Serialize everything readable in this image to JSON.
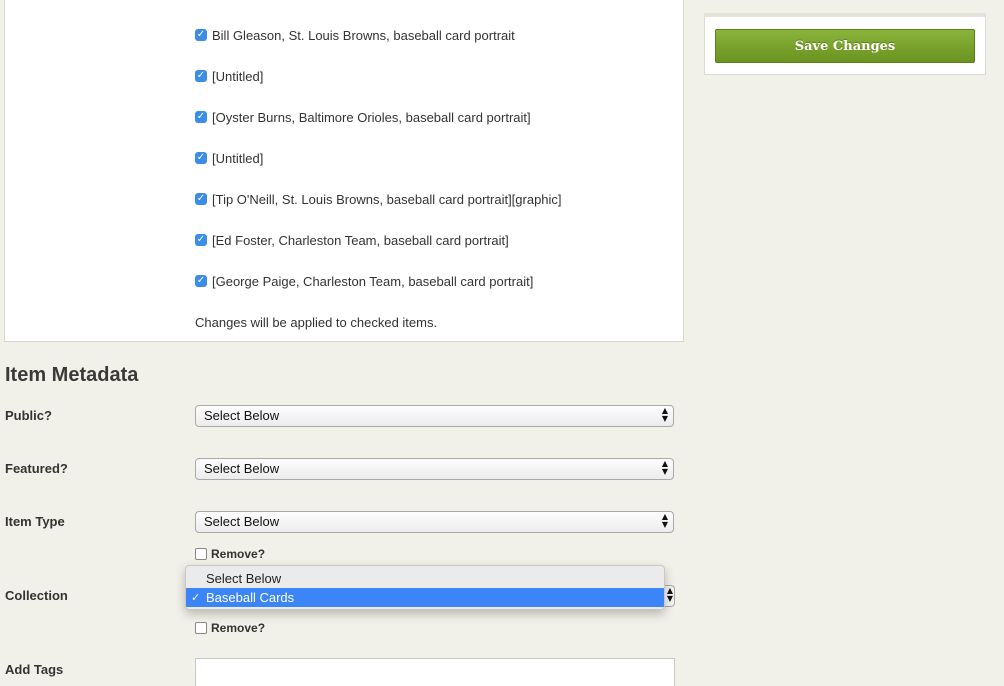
{
  "selected_items": [
    "Bill Gleason, St. Louis Browns, baseball card portrait",
    "[Untitled]",
    "[Oyster Burns, Baltimore Orioles, baseball card portrait]",
    "[Untitled]",
    "[Tip O'Neill, St. Louis Browns, baseball card portrait][graphic]",
    "[Ed Foster, Charleston Team, baseball card portrait]",
    "[George Paige, Charleston Team, baseball card portrait]"
  ],
  "note": "Changes will be applied to checked items.",
  "save_button": "Save Changes",
  "metadata": {
    "title": "Item Metadata",
    "public_label": "Public?",
    "public_value": "Select Below",
    "featured_label": "Featured?",
    "featured_value": "Select Below",
    "item_type_label": "Item Type",
    "item_type_value": "Select Below",
    "item_type_remove": "Remove?",
    "collection_label": "Collection",
    "collection_options": [
      "Select Below",
      "Baseball Cards"
    ],
    "collection_selected": "Baseball Cards",
    "collection_remove": "Remove?",
    "tags_label": "Add Tags"
  },
  "colors": {
    "accent_checkbox": "#3b8de8",
    "save_button": "#7aa32c",
    "dropdown_highlight": "#3c85f7"
  },
  "icons": {
    "checkbox": "checkmark-icon",
    "select": "updown-arrows-icon"
  }
}
